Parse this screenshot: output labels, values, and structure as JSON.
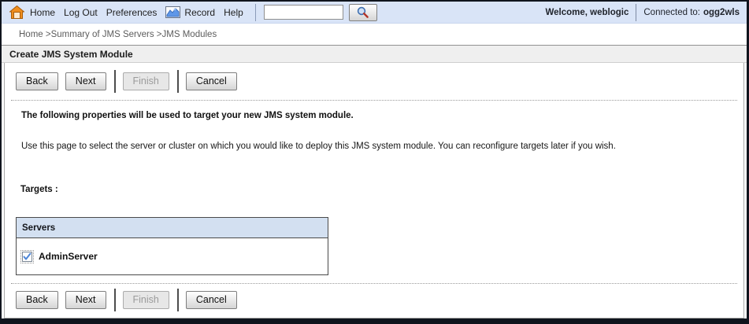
{
  "header": {
    "nav": {
      "home": "Home",
      "logout": "Log Out",
      "preferences": "Preferences",
      "record": "Record",
      "help": "Help"
    },
    "search": {
      "value": "",
      "placeholder": ""
    },
    "welcome_text": "Welcome, weblogic",
    "connected_label": "Connected to:",
    "connected_value": "ogg2wls"
  },
  "breadcrumb": {
    "items": [
      "Home",
      "Summary of JMS Servers",
      "JMS Modules"
    ],
    "separator": " >"
  },
  "page": {
    "title": "Create JMS System Module"
  },
  "wizard": {
    "buttons": {
      "back": "Back",
      "next": "Next",
      "finish": "Finish",
      "cancel": "Cancel"
    },
    "finish_disabled": true,
    "intro_bold": "The following properties will be used to target your new JMS system module.",
    "description": "Use this page to select the server or cluster on which you would like to deploy this JMS system module. You can reconfigure targets later if you wish.",
    "targets_label": "Targets :"
  },
  "servers_table": {
    "header": "Servers",
    "rows": [
      {
        "name": "AdminServer",
        "checked": true
      }
    ]
  },
  "icons": {
    "home": "home-icon",
    "record": "record-chart-icon",
    "search": "magnifier-icon",
    "checkbox": "checked-checkbox"
  },
  "colors": {
    "topbar_bg": "#d9e4f7",
    "table_header_bg": "#d3e0f1",
    "frame": "#10141d",
    "titlebar_bg": "#efefef",
    "home_icon_orange": "#ef8e1f",
    "check_blue": "#4d86d8"
  }
}
